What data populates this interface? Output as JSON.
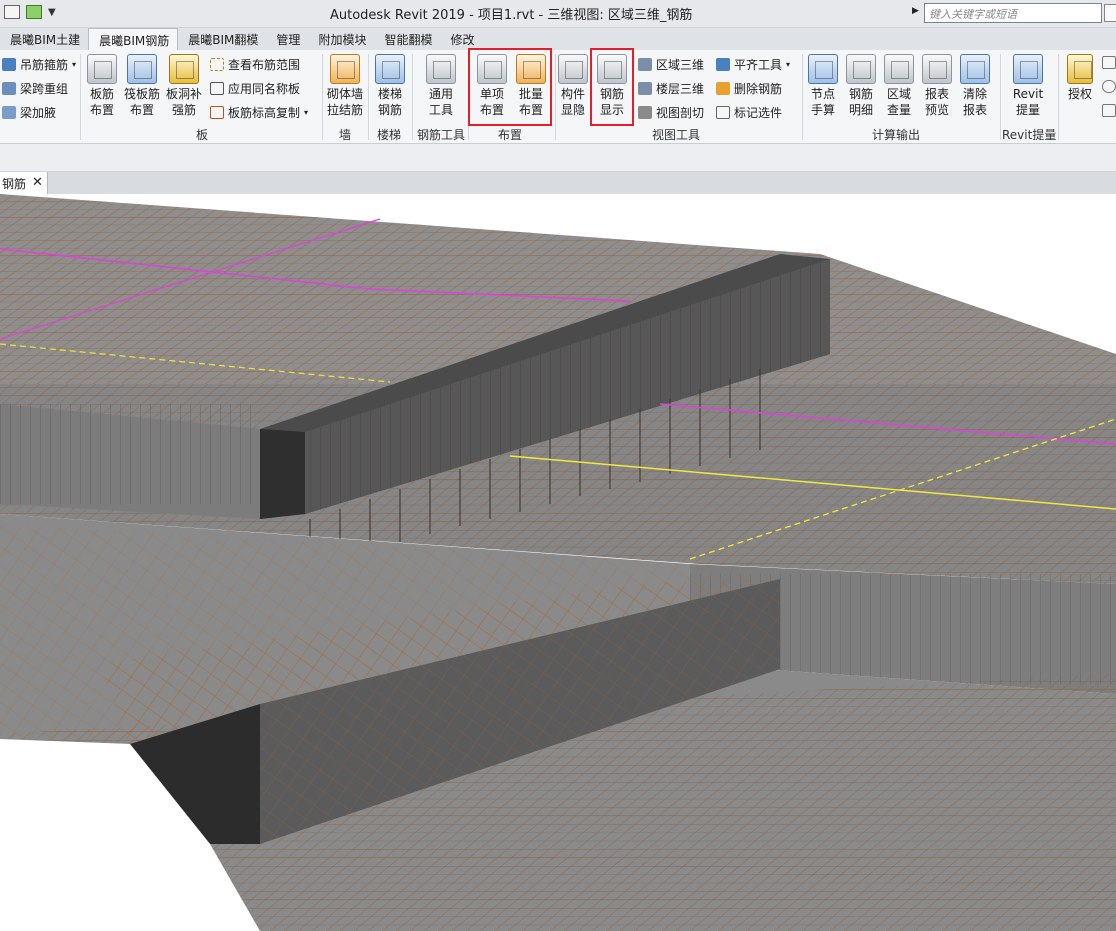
{
  "window": {
    "title": "Autodesk Revit 2019 - 项目1.rvt - 三维视图: 区域三维_钢筋",
    "search_placeholder": "键入关键字或短语"
  },
  "tabs": [
    {
      "label": "晨曦BIM土建",
      "active": false
    },
    {
      "label": "晨曦BIM钢筋",
      "active": true
    },
    {
      "label": "晨曦BIM翻模",
      "active": false
    },
    {
      "label": "管理",
      "active": false
    },
    {
      "label": "附加模块",
      "active": false
    },
    {
      "label": "智能翻模",
      "active": false
    },
    {
      "label": "修改",
      "active": false
    }
  ],
  "ribbon": {
    "left_small": [
      "吊筋箍筋",
      "梁跨重组",
      "梁加腋"
    ],
    "board": {
      "buttons": [
        [
          "板筋",
          "布置"
        ],
        [
          "筏板筋",
          "布置"
        ],
        [
          "板洞补",
          "强筋"
        ]
      ],
      "small": [
        "查看布筋范围",
        "应用同名称板",
        "板筋标高复制"
      ],
      "label": "板"
    },
    "wall": {
      "button": [
        "砌体墙",
        "拉结筋"
      ],
      "label": "墙"
    },
    "stair": {
      "button": [
        "楼梯",
        "钢筋"
      ],
      "label": "楼梯"
    },
    "tools": {
      "button": [
        "通用",
        "工具"
      ],
      "label": "钢筋工具"
    },
    "place": {
      "buttons": [
        [
          "单项",
          "布置"
        ],
        [
          "批量",
          "布置"
        ]
      ],
      "label": "布置"
    },
    "view": {
      "buttons": [
        [
          "构件",
          "显隐"
        ],
        [
          "钢筋",
          "显示"
        ]
      ],
      "small": [
        "区域三维",
        "楼层三维",
        "视图剖切"
      ],
      "small2": [
        "平齐工具",
        "删除钢筋",
        "标记选件"
      ],
      "label": "视图工具"
    },
    "calc": {
      "buttons": [
        [
          "节点",
          "手算"
        ],
        [
          "钢筋",
          "明细"
        ],
        [
          "区域",
          "查量"
        ],
        [
          "报表",
          "预览"
        ],
        [
          "清除",
          "报表"
        ]
      ],
      "label": "计算输出"
    },
    "revit": {
      "button": [
        "Revit",
        "提量"
      ],
      "label": "Revit提量"
    },
    "auth": {
      "button": "授权"
    }
  },
  "view_tab": {
    "label": "钢筋"
  },
  "colors": {
    "highlight": "#e0202a",
    "rebar": "#a05a2c",
    "concrete": "#8c8c8c"
  }
}
